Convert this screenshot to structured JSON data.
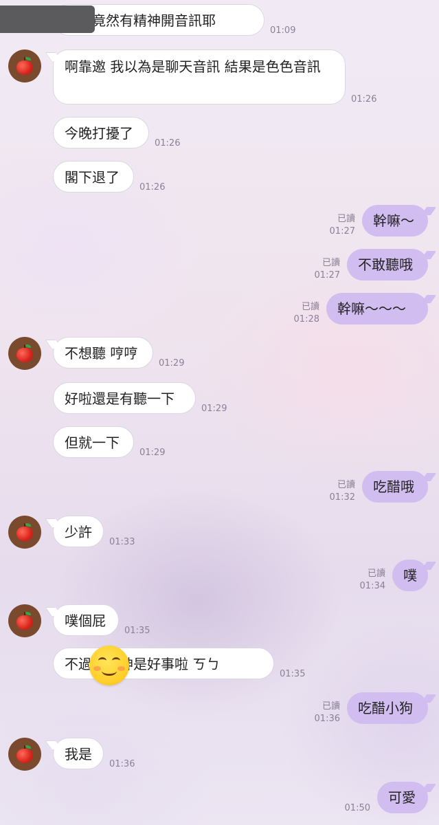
{
  "messages": [
    {
      "dir": "in",
      "avatar": false,
      "text": "今天竟然有精神開音訊耶",
      "time": "01:09",
      "read": ""
    },
    {
      "dir": "in",
      "avatar": true,
      "text": "啊靠邀 我以為是聊天音訊 結果是色色音訊",
      "time": "01:26",
      "read": ""
    },
    {
      "dir": "in",
      "avatar": false,
      "text": "今晚打擾了",
      "time": "01:26",
      "read": ""
    },
    {
      "dir": "in",
      "avatar": false,
      "text": "閣下退了",
      "time": "01:26",
      "read": ""
    },
    {
      "dir": "out",
      "text": "幹嘛～",
      "time": "01:27",
      "read": "已讀"
    },
    {
      "dir": "out",
      "text": "不敢聽哦",
      "time": "01:27",
      "read": "已讀"
    },
    {
      "dir": "out",
      "text": "幹嘛～～～",
      "time": "01:28",
      "read": "已讀"
    },
    {
      "dir": "in",
      "avatar": true,
      "text": "不想聽 哼哼",
      "time": "01:29",
      "read": ""
    },
    {
      "dir": "in",
      "avatar": false,
      "text": "好啦還是有聽一下",
      "time": "01:29",
      "read": ""
    },
    {
      "dir": "in",
      "avatar": false,
      "text": "但就一下",
      "time": "01:29",
      "read": ""
    },
    {
      "dir": "out",
      "text": "吃醋哦",
      "time": "01:32",
      "read": "已讀"
    },
    {
      "dir": "in",
      "avatar": true,
      "text": "少許",
      "time": "01:33",
      "read": ""
    },
    {
      "dir": "out",
      "text": "噗",
      "time": "01:34",
      "read": "已讀"
    },
    {
      "dir": "in",
      "avatar": true,
      "text": "噗個屁",
      "time": "01:35",
      "read": ""
    },
    {
      "dir": "in",
      "avatar": false,
      "text": "不過有精神是好事啦 ㄎㄅ",
      "time": "01:35",
      "read": ""
    },
    {
      "dir": "out",
      "text": "吃醋小狗",
      "time": "01:36",
      "read": "已讀"
    },
    {
      "dir": "in",
      "avatar": true,
      "text": "我是",
      "time": "01:36",
      "read": ""
    },
    {
      "dir": "out",
      "text": "可愛",
      "time": "01:50",
      "read": ""
    }
  ],
  "sticker": {
    "icon": "smiling-face-emoji-icon"
  },
  "avatar_icon": "apple-icon"
}
